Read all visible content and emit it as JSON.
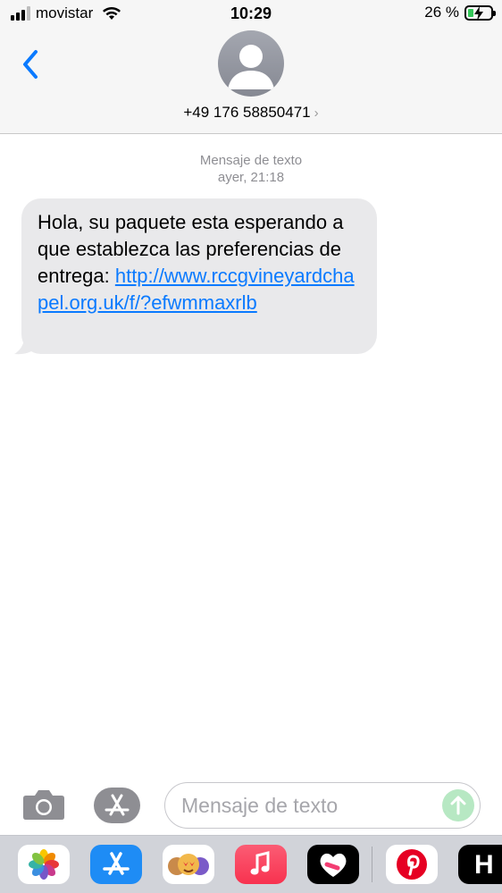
{
  "status_bar": {
    "carrier": "movistar",
    "time": "10:29",
    "battery_text": "26 %",
    "battery_level": 0.26
  },
  "header": {
    "contact": "+49 176 58850471",
    "chevron": "›"
  },
  "conversation": {
    "service_label": "Mensaje de texto",
    "timestamp": "ayer, 21:18",
    "messages": [
      {
        "text": "Hola, su paquete esta esperando a que establezca las preferencias de entrega: ",
        "link": "http://www.rccgvineyardchapel.org.uk/f/?efwmmaxrlb"
      }
    ]
  },
  "composer": {
    "placeholder": "Mensaje de texto"
  },
  "icons": {
    "back": "chevron-left-icon",
    "camera": "camera-icon",
    "app_store": "app-store-icon",
    "send": "send-arrow-icon"
  },
  "app_strip": [
    {
      "name": "photos-app-icon"
    },
    {
      "name": "app-store-app-icon"
    },
    {
      "name": "memoji-app-icon"
    },
    {
      "name": "music-app-icon"
    },
    {
      "name": "heart-app-icon"
    },
    {
      "name": "pinterest-app-icon"
    },
    {
      "name": "h-app-icon",
      "label": "H"
    }
  ],
  "colors": {
    "link": "#0a7aff",
    "bubble": "#e9e9eb",
    "accent": "#0a7aff",
    "send_disabled": "#b7e8c3"
  }
}
